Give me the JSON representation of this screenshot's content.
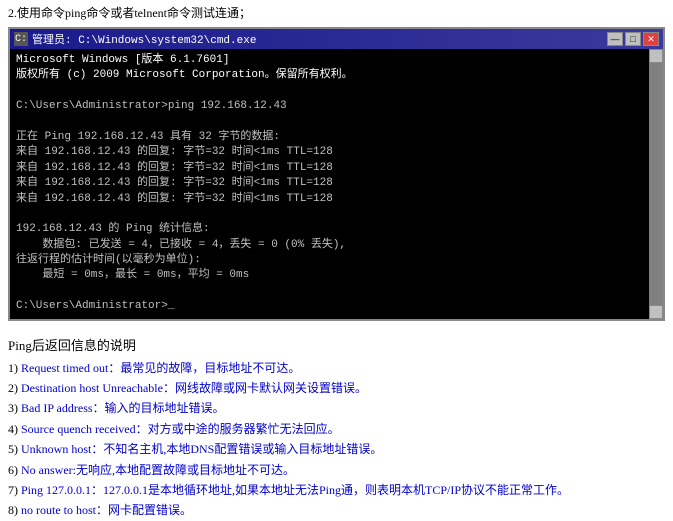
{
  "instruction": "2.使用命令ping命令或者telnent命令测试连通；",
  "cmd": {
    "titlebar": "管理员: C:\\Windows\\system32\\cmd.exe",
    "lines": [
      "Microsoft Windows [版本 6.1.7601]",
      "版权所有 (c) 2009 Microsoft Corporation。保留所有权利。",
      "",
      "C:\\Users\\Administrator>ping 192.168.12.43",
      "",
      "正在 Ping 192.168.12.43 具有 32 字节的数据:",
      "来自 192.168.12.43 的回复: 字节=32 时间<1ms TTL=128",
      "来自 192.168.12.43 的回复: 字节=32 时间<1ms TTL=128",
      "来自 192.168.12.43 的回复: 字节=32 时间<1ms TTL=128",
      "来自 192.168.12.43 的回复: 字节=32 时间<1ms TTL=128",
      "",
      "192.168.12.43 的 Ping 统计信息:",
      "    数据包: 已发送 = 4，已接收 = 4，丢失 = 0 (0% 丢失),",
      "往返行程的估计时间(以毫秒为单位):",
      "    最短 = 0ms，最长 = 0ms，平均 = 0ms",
      "",
      "C:\\Users\\Administrator>_"
    ]
  },
  "section_title": "Ping后返回信息的说明",
  "items": [
    {
      "number": "1)",
      "text": "Request timed out：最常见的故障，目标地址不可达。"
    },
    {
      "number": "2)",
      "text": "Destination host Unreachable：网线故障或网卡默认网关设置错误。"
    },
    {
      "number": "3)",
      "text": "Bad IP address：输入的目标地址错误。"
    },
    {
      "number": "4)",
      "text": "Source quench received：对方或中途的服务器繁忙无法回应。"
    },
    {
      "number": "5)",
      "text": "Unknown host：不知名主机,本地DNS配置错误或输入目标地址错误。"
    },
    {
      "number": "6)",
      "text": "No answer:无响应,本地配置故障或目标地址不可达。"
    },
    {
      "number": "7)",
      "text": "Ping 127.0.0.1：127.0.0.1是本地循环地址,如果本地址无法Ping通，则表明本机TCP/IP协议不能正常工作。"
    },
    {
      "number": "8)",
      "text": "no route to host：网卡配置错误。"
    }
  ],
  "controls": {
    "minimize": "—",
    "maximize": "□",
    "close": "✕"
  }
}
